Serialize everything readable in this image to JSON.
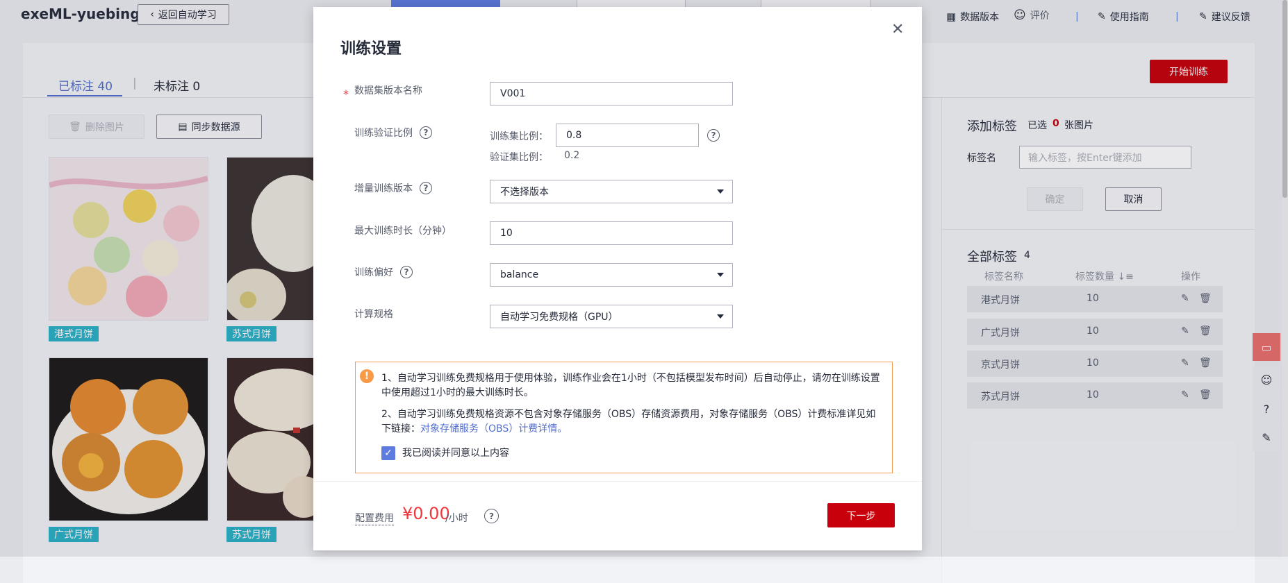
{
  "header": {
    "app_title": "exeML-yuebing",
    "back_label": "返回自动学习",
    "links": [
      {
        "label": "数据版本",
        "icon": "grid-icon"
      },
      {
        "label": "评价",
        "icon": "smiley-icon"
      },
      {
        "label": "使用指南",
        "icon": "edit-icon"
      },
      {
        "label": "建议反馈",
        "icon": "feedback-icon"
      }
    ],
    "separator": "|"
  },
  "tabs": [
    {
      "label": "已标注 40",
      "active": true
    },
    {
      "label": "未标注 0",
      "active": false
    }
  ],
  "toolbar": {
    "delete_label": "删除图片",
    "sync_label": "同步数据源",
    "start_label": "开始训练"
  },
  "images": [
    {
      "tag": "港式月饼"
    },
    {
      "tag": "苏式月饼"
    },
    {
      "tag": "广式月饼"
    },
    {
      "tag": "苏式月饼"
    }
  ],
  "add_label": {
    "title": "添加标签",
    "selected_prefix": "已选",
    "selected_count": "0",
    "selected_suffix": "张图片",
    "name_label": "标签名",
    "input_placeholder": "输入标签，按Enter键添加",
    "confirm_label": "确定",
    "cancel_label": "取消"
  },
  "all_labels": {
    "title": "全部标签",
    "count": "4",
    "col_name": "标签名称",
    "col_count": "标签数量",
    "col_action": "操作",
    "rows": [
      {
        "name": "港式月饼",
        "count": "10"
      },
      {
        "name": "广式月饼",
        "count": "10"
      },
      {
        "name": "京式月饼",
        "count": "10"
      },
      {
        "name": "苏式月饼",
        "count": "10"
      }
    ]
  },
  "modal": {
    "title": "训练设置",
    "required_mark": "*",
    "dataset_version_label": "数据集版本名称",
    "dataset_version_value": "V001",
    "split_label": "训练验证比例",
    "train_ratio_label": "训练集比例：",
    "train_ratio_value": "0.8",
    "val_ratio_label": "验证集比例：",
    "val_ratio_value": "0.2",
    "incremental_label": "增量训练版本",
    "incremental_value": "不选择版本",
    "max_time_label": "最大训练时长（分钟）",
    "max_time_value": "10",
    "preference_label": "训练偏好",
    "preference_value": "balance",
    "spec_label": "计算规格",
    "spec_value": "自动学习免费规格（GPU）",
    "notice_1": "1、自动学习训练免费规格用于使用体验，训练作业会在1小时（不包括模型发布时间）后自动停止，请勿在训练设置中使用超过1小时的最大训练时长。",
    "notice_2": "2、自动学习训练免费规格资源不包含对象存储服务（OBS）存储资源费用，对象存储服务（OBS）计费标准详见如下链接：",
    "notice_link": "对象存储服务（OBS）计费详情。",
    "agree_label": "我已阅读并同意以上内容",
    "fee_label": "配置费用",
    "fee_value": "¥0.00",
    "fee_unit": "/小时",
    "next_label": "下一步"
  },
  "colors": {
    "primary_red": "#c7000b",
    "accent_blue": "#526ecc",
    "tag_teal": "#2ab0c7",
    "warning_orange": "#f89a47",
    "price_red": "#f1363c"
  }
}
